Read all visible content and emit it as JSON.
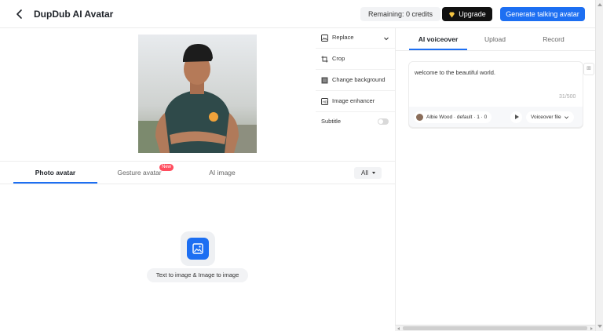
{
  "header": {
    "title": "DupDub AI Avatar",
    "credits": "Remaining: 0 credits",
    "upgrade_label": "Upgrade",
    "generate_label": "Generate talking avatar"
  },
  "tools": {
    "replace": "Replace",
    "crop": "Crop",
    "change_background": "Change background",
    "image_enhancer": "Image enhancer",
    "subtitle": "Subtitle",
    "subtitle_on": false
  },
  "left_tabs": {
    "photo_avatar": "Photo avatar",
    "gesture_avatar": "Gesture avatar",
    "new_badge": "New",
    "ai_image": "AI image",
    "filter": "All"
  },
  "empty_state": {
    "label": "Text to image & Image to image"
  },
  "right_tabs": {
    "ai_voiceover": "AI voiceover",
    "upload": "Upload",
    "record": "Record"
  },
  "script_editor": {
    "text": "welcome to the beautiful world.",
    "count": "31/500"
  },
  "voice": {
    "name": "Albie Wood · default · 1 · 0",
    "file_label": "Voiceover file"
  },
  "colors": {
    "accent": "#1d6ff2",
    "badge": "#ff4d5e"
  }
}
